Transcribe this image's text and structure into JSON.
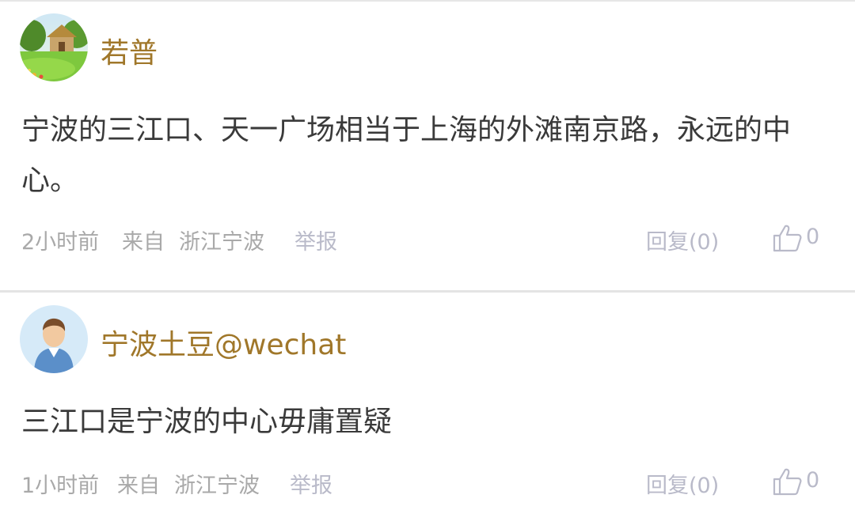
{
  "comments": [
    {
      "username": "若普",
      "text": "宁波的三江口、天一广场相当于上海的外滩南京路，永远的中心。",
      "time": "2小时前",
      "source_prefix": "来自",
      "source_location": "浙江宁波",
      "report_label": "举报",
      "reply_label": "回复(0)",
      "like_count": "0"
    },
    {
      "username": "宁波土豆@wechat",
      "text": "三江口是宁波的中心毋庸置疑",
      "time": "1小时前",
      "source_prefix": "来自",
      "source_location": "浙江宁波",
      "report_label": "举报",
      "reply_label": "回复(0)",
      "like_count": "0"
    }
  ],
  "colors": {
    "username": "#a0772a",
    "body_text": "#3a3a3a",
    "meta_text": "#a9a9a9",
    "action_text": "#b9bac9",
    "divider": "#e4e4e4"
  },
  "icons": {
    "like": "thumbs-up-icon",
    "avatar1": "cottage-landscape-avatar",
    "avatar2": "default-user-avatar"
  }
}
